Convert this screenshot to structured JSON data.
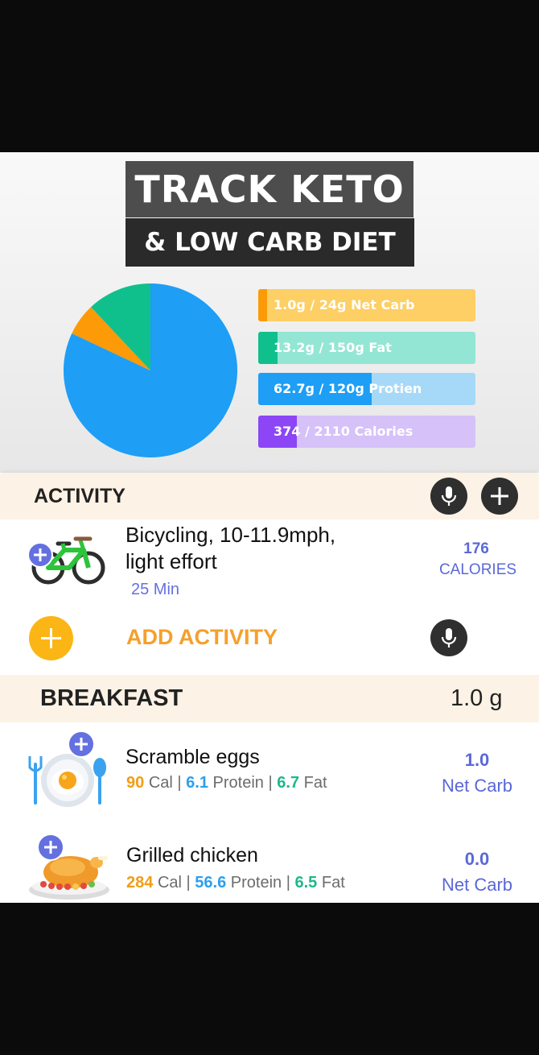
{
  "hero": {
    "title_line1": "TRACK KETO",
    "title_line2": "& LOW CARB DIET"
  },
  "macros": [
    {
      "label": "1.0g / 24g Net Carb",
      "fraction": 0.042,
      "fill_color": "#fc9a07",
      "track_color": "#fdcf64"
    },
    {
      "label": "13.2g / 150g  Fat",
      "fraction": 0.088,
      "fill_color": "#10c08c",
      "track_color": "#94e6d4"
    },
    {
      "label": "62.7g / 120g Protien",
      "fraction": 0.5225,
      "fill_color": "#1e9ef5",
      "track_color": "#a6d9f7"
    },
    {
      "label": "374 / 2110 Calories",
      "fraction": 0.177,
      "fill_color": "#8c46f5",
      "track_color": "#d6c1f8"
    }
  ],
  "pie": {
    "slices": [
      {
        "name": "protein",
        "fraction": 0.82,
        "color": "#1e9ef5"
      },
      {
        "name": "carb",
        "fraction": 0.06,
        "color": "#fc9a07"
      },
      {
        "name": "fat",
        "fraction": 0.12,
        "color": "#10c08c"
      }
    ]
  },
  "activity": {
    "header": "ACTIVITY",
    "item": {
      "name_line1": "Bicycling, 10-11.9mph,",
      "name_line2": "light effort",
      "duration": "25 Min",
      "calories_value": "176",
      "calories_label": "CALORIES"
    },
    "add_label": "ADD ACTIVITY"
  },
  "breakfast": {
    "header": "BREAKFAST",
    "total": "1.0 g",
    "items": [
      {
        "name": "Scramble eggs",
        "cal": "90",
        "protein": "6.1",
        "fat": "6.7",
        "net_carb": "1.0"
      },
      {
        "name": "Grilled chicken",
        "cal": "284",
        "protein": "56.6",
        "fat": "6.5",
        "net_carb": "0.0"
      }
    ],
    "cal_unit": "Cal",
    "protein_unit": "Protein",
    "fat_unit": "Fat",
    "sep": "|",
    "net_carb_label": "Net Carb"
  },
  "colors": {
    "accent_orange": "#f29d15",
    "accent_blue": "#2c9fee",
    "accent_green": "#1eb88c",
    "accent_purple": "#5a68d8"
  }
}
